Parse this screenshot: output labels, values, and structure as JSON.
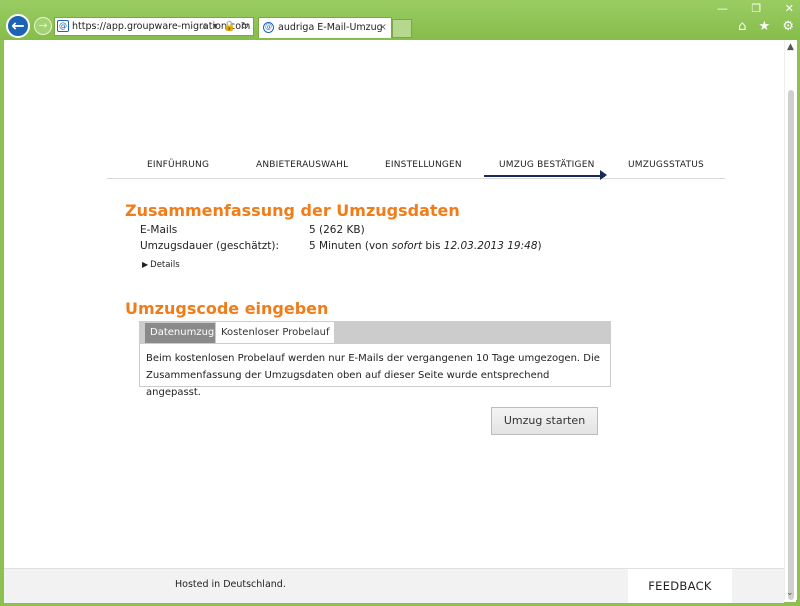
{
  "browser": {
    "url": "https://app.groupware-migration.com",
    "tab_title": "audriga E-Mail-Umzug",
    "tab_close": "×",
    "address_tools": "⌕ ▾ 🔒 ↻",
    "window_controls": [
      "—",
      "❐",
      "✕"
    ],
    "right_icons": [
      "⌂",
      "★",
      "⚙"
    ]
  },
  "steps": [
    {
      "label": "EINFÜHRUNG"
    },
    {
      "label": "ANBIETERAUSWAHL"
    },
    {
      "label": "EINSTELLUNGEN"
    },
    {
      "label": "UMZUG BESTÄTIGEN",
      "active": true
    },
    {
      "label": "UMZUGSSTATUS"
    }
  ],
  "summary": {
    "title": "Zusammenfassung der Umzugsdaten",
    "emails_label": "E-Mails",
    "emails_value": "5 (262 KB)",
    "duration_label": "Umzugsdauer (geschätzt):",
    "duration_prefix": "5 Minuten (von ",
    "duration_from": "sofort",
    "duration_mid": " bis ",
    "duration_to": "12.03.2013 19:48",
    "duration_suffix": ")",
    "details_label": "Details"
  },
  "code": {
    "title": "Umzugscode eingeben",
    "tabs": [
      "Datenumzug",
      "Kostenloser Probelauf"
    ],
    "active_tab": "Kostenloser Probelauf",
    "content": "Beim kostenlosen Probelauf werden nur E-Mails der vergangenen 10 Tage umgezogen. Die Zusammenfassung der Umzugsdaten oben auf dieser Seite wurde entsprechend angepasst."
  },
  "start_button": "Umzug starten",
  "footer": {
    "hosted": "Hosted in Deutschland.",
    "feedback": "FEEDBACK"
  },
  "colors": {
    "accent_orange": "#f07d1a",
    "chrome_green": "#8cc152",
    "step_active": "#1a2a5a"
  }
}
